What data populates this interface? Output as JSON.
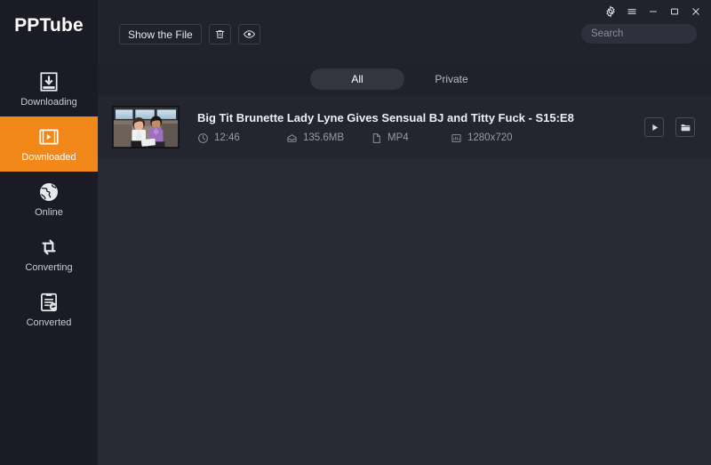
{
  "app": {
    "brand": "PPTube",
    "accent_color": "#f2881a",
    "sidebar_bg": "#1a1b25",
    "header_bg": "#20222c",
    "content_bg": "#282a33",
    "row_bg": "#23252f"
  },
  "window_controls": [
    {
      "name": "settings-button",
      "icon": "gear-icon",
      "label": "Settings"
    },
    {
      "name": "menu-button",
      "icon": "hamburger-icon",
      "label": "Menu"
    },
    {
      "name": "minimize-button",
      "icon": "minimize-icon",
      "label": "Minimize"
    },
    {
      "name": "maximize-button",
      "icon": "maximize-icon",
      "label": "Maximize"
    },
    {
      "name": "close-button",
      "icon": "close-icon",
      "label": "Close"
    }
  ],
  "toolbar": {
    "show_file_label": "Show the File",
    "delete_icon": "trash-icon",
    "preview_icon": "eye-icon"
  },
  "search": {
    "placeholder": "Search",
    "value": ""
  },
  "sidebar": {
    "items": [
      {
        "label": "Downloading",
        "icon": "download-box-icon",
        "active": false
      },
      {
        "label": "Downloaded",
        "icon": "film-play-icon",
        "active": true
      },
      {
        "label": "Online",
        "icon": "globe-icon",
        "active": false
      },
      {
        "label": "Converting",
        "icon": "convert-arrows-icon",
        "active": false
      },
      {
        "label": "Converted",
        "icon": "clipboard-refresh-icon",
        "active": false
      }
    ]
  },
  "tabs": [
    {
      "label": "All",
      "active": true
    },
    {
      "label": "Private",
      "active": false
    }
  ],
  "list": {
    "items": [
      {
        "title": "Big Tit Brunette Lady Lyne Gives Sensual BJ and Titty Fuck - S15:E8",
        "duration": "12:46",
        "size": "135.6MB",
        "format": "MP4",
        "resolution": "1280x720",
        "duration_icon": "clock-icon",
        "size_icon": "box-icon",
        "format_icon": "file-icon",
        "resolution_icon": "image-icon",
        "play_icon": "play-icon",
        "folder_icon": "folder-icon"
      }
    ]
  }
}
